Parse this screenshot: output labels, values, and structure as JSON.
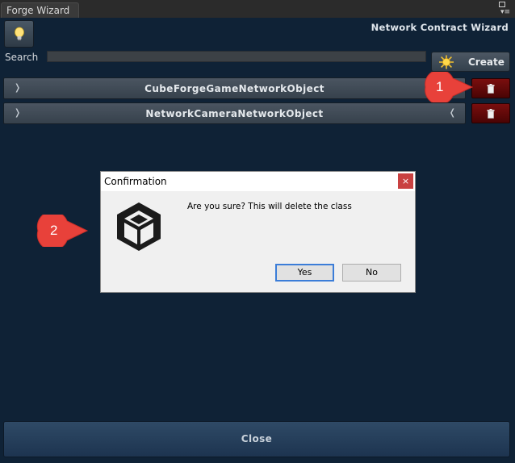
{
  "window": {
    "tab_title": "Forge Wizard"
  },
  "header": {
    "title": "Network Contract Wizard"
  },
  "search": {
    "label": "Search",
    "value": ""
  },
  "toolbar": {
    "create_label": "Create"
  },
  "classes": [
    {
      "name": "CubeForgeGameNetworkObject"
    },
    {
      "name": "NetworkCameraNetworkObject"
    }
  ],
  "footer": {
    "close_label": "Close"
  },
  "callouts": {
    "one": "1",
    "two": "2"
  },
  "dialog": {
    "title": "Confirmation",
    "close_glyph": "×",
    "message": "Are you sure? This will delete the class",
    "yes_label": "Yes",
    "no_label": "No"
  },
  "colors": {
    "callout": "#e8413a",
    "delete": "#6b0909",
    "accent": "#3b7dd8"
  }
}
